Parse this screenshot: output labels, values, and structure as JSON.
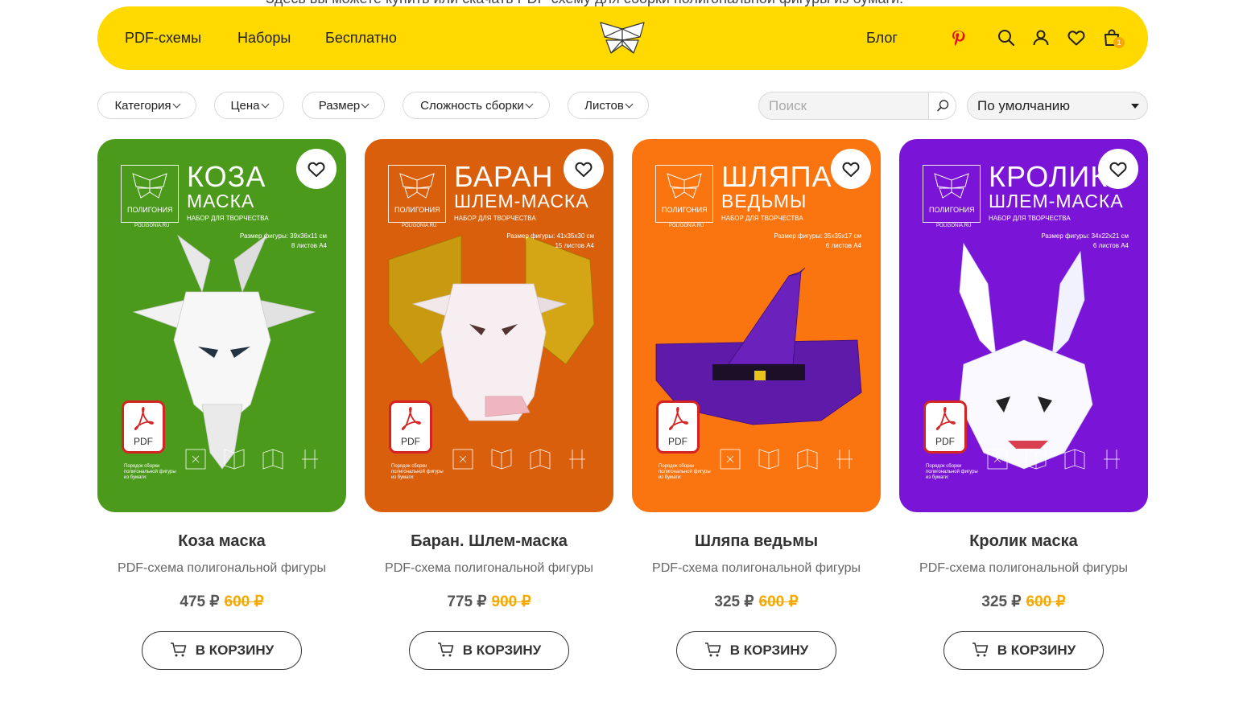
{
  "top_text": "Здесь вы можете купить или скачать PDF-схему для сборки полигональной фигуры из бумаги.",
  "header": {
    "nav": [
      "PDF-схемы",
      "Наборы",
      "Бесплатно"
    ],
    "blog": "Блог",
    "cart_count": "1",
    "icons": [
      "butterfly-logo",
      "pinterest-icon",
      "search-icon",
      "user-icon",
      "heart-icon",
      "bag-icon"
    ]
  },
  "filters": {
    "items": [
      "Категория",
      "Цена",
      "Размер",
      "Сложность сборки",
      "Листов"
    ],
    "search_placeholder": "Поиск",
    "sort_value": "По умолчанию"
  },
  "products": [
    {
      "name": "Коза маска",
      "subtitle": "PDF-схема полигональной фигуры",
      "price": "475 ₽",
      "old_price": "600 ₽",
      "cart_label": "В КОРЗИНУ",
      "color": "#4c9a1c",
      "poster_title": "КОЗА",
      "poster_subtitle": "МАСКА",
      "size_text": "Размер фигуры: 39х36х11 см",
      "sheets_text": "8 листов А4"
    },
    {
      "name": "Баран. Шлем-маска",
      "subtitle": "PDF-схема полигональной фигуры",
      "price": "775 ₽",
      "old_price": "900 ₽",
      "cart_label": "В КОРЗИНУ",
      "color": "#d95f0c",
      "poster_title": "БАРАН",
      "poster_subtitle": "ШЛЕМ-МАСКА",
      "size_text": "Размер фигуры: 41х35х30 см",
      "sheets_text": "15 листов А4"
    },
    {
      "name": "Шляпа ведьмы",
      "subtitle": "PDF-схема полигональной фигуры",
      "price": "325 ₽",
      "old_price": "600 ₽",
      "cart_label": "В КОРЗИНУ",
      "color": "#fa7410",
      "poster_title": "ШЛЯПА",
      "poster_subtitle": "ВЕДЬМЫ",
      "size_text": "Размер фигуры: 35х35х17 см",
      "sheets_text": "6 листов А4"
    },
    {
      "name": "Кролик маска",
      "subtitle": "PDF-схема полигональной фигуры",
      "price": "325 ₽",
      "old_price": "600 ₽",
      "cart_label": "В КОРЗИНУ",
      "color": "#7a14d6",
      "poster_title": "КРОЛИК",
      "poster_subtitle": "ШЛЕМ-МАСКА",
      "size_text": "Размер фигуры: 34х22х21 см",
      "sheets_text": "6 листов А4"
    }
  ],
  "poster_common": {
    "brand": "ПОЛИГОНИЯ",
    "site": "POLIGONIA.RU",
    "nabor": "НАБОР ДЛЯ ТВОРЧЕСТВА",
    "pdf": "PDF",
    "order": "Порядок сборки полигональной фигуры из бумаги:"
  }
}
